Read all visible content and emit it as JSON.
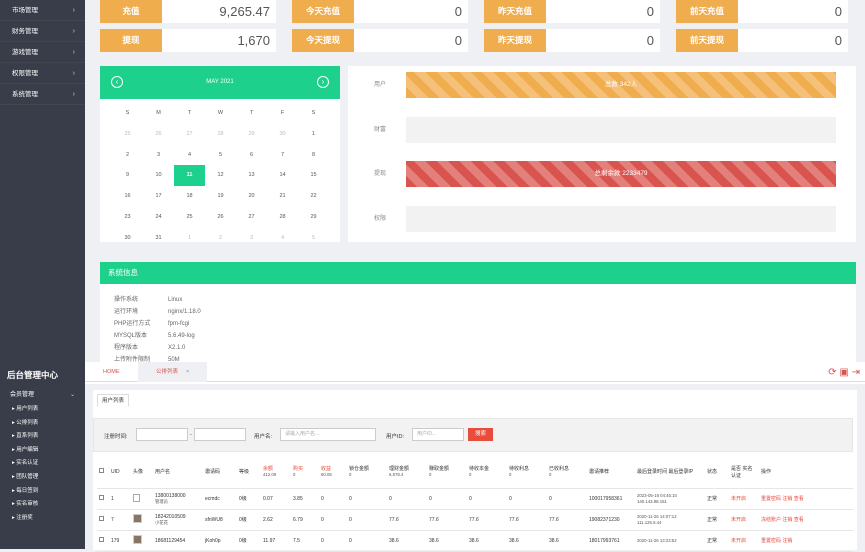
{
  "top_sidebar": {
    "items": [
      "市场管理",
      "财务管理",
      "游戏管理",
      "权限管理",
      "系统管理"
    ]
  },
  "stats": {
    "row1": [
      {
        "label": "充值",
        "value": "9,265.47"
      },
      {
        "label": "今天充值",
        "value": "0"
      },
      {
        "label": "昨天充值",
        "value": "0"
      },
      {
        "label": "前天充值",
        "value": "0"
      }
    ],
    "row2": [
      {
        "label": "提现",
        "value": "1,670"
      },
      {
        "label": "今天提现",
        "value": "0"
      },
      {
        "label": "昨天提现",
        "value": "0"
      },
      {
        "label": "前天提现",
        "value": "0"
      }
    ]
  },
  "calendar": {
    "month_label": "MAY 2021",
    "weekdays": [
      "S",
      "M",
      "T",
      "W",
      "T",
      "F",
      "S"
    ],
    "weeks": [
      [
        "25",
        "26",
        "27",
        "28",
        "29",
        "30",
        "1"
      ],
      [
        "2",
        "3",
        "4",
        "5",
        "6",
        "7",
        "8"
      ],
      [
        "9",
        "10",
        "11",
        "12",
        "13",
        "14",
        "15"
      ],
      [
        "16",
        "17",
        "18",
        "19",
        "20",
        "21",
        "22"
      ],
      [
        "23",
        "24",
        "25",
        "26",
        "27",
        "28",
        "29"
      ],
      [
        "30",
        "31",
        "1",
        "2",
        "3",
        "4",
        "5"
      ]
    ],
    "today": "11"
  },
  "progress": {
    "rows": [
      {
        "label": "用户",
        "text": "总数 342人",
        "fill": 1.0,
        "color": "orange"
      },
      {
        "label": "财富",
        "text": "",
        "fill": 0,
        "color": "none"
      },
      {
        "label": "提现",
        "text": "总剩余款 2233479",
        "fill": 1.0,
        "color": "red"
      },
      {
        "label": "权限",
        "text": "",
        "fill": 0,
        "color": "none"
      }
    ]
  },
  "sysinfo": {
    "title": "系统信息",
    "rows": [
      {
        "k": "操作系统",
        "v": "Linux"
      },
      {
        "k": "运行环境",
        "v": "nginx/1.18.0"
      },
      {
        "k": "PHP运行方式",
        "v": "fpm-fcgi"
      },
      {
        "k": "MYSQL版本",
        "v": "5.6.49-log"
      },
      {
        "k": "程序版本",
        "v": "X2.1.0"
      },
      {
        "k": "上传附件限制",
        "v": "50M"
      }
    ]
  },
  "sidebar": {
    "brand": "后台管理中心",
    "group": "会员管理",
    "items": [
      "用户列表",
      "公排列表",
      "直系列表",
      "用户编辑",
      "实名认证",
      "团队管理",
      "每日签到",
      "实名审核",
      "注册奖"
    ]
  },
  "tabs": {
    "home": "HOME",
    "current": "公排列表",
    "close": "×"
  },
  "panel": {
    "tab": "用户列表",
    "filter": {
      "time_label": "注册时间:",
      "dash": "-",
      "user_label": "用户名:",
      "user_placeholder": "请输入用户名...",
      "uid_label": "用户ID:",
      "uid_placeholder": "用户ID...",
      "search_btn": "搜索"
    },
    "headers": [
      "UID",
      "头像",
      "用户名",
      "邀请码",
      "等级",
      "余额",
      "购买",
      "收益",
      "锁仓金额",
      "理财金额",
      "赚取金额",
      "待收本金",
      "待收利息",
      "已收利息",
      "邀请推荐",
      "最后登录时间 最后登录IP",
      "状态",
      "是否 实名认证",
      "操作"
    ],
    "header_sub": {
      "余额": "412.09",
      "购买": "0",
      "收益": "60.05",
      "锁仓金额": "0",
      "理财金额": "6,578.4",
      "赚取金额": "0",
      "待收本金": "0",
      "待收利息": "0",
      "已收利息": "0"
    },
    "rows": [
      {
        "uid": "1",
        "avatar": "broken",
        "user": "13800138000 ",
        "user2": "管理员",
        "code": "ecmdc",
        "level": "0级",
        "bal": "0.07",
        "buy": "3.85",
        "inc": "0",
        "lock": "0",
        "fin": "0",
        "earn": "0",
        "prin": "0",
        "intr": "0",
        "got": "0",
        "inv": "100017958361",
        "login": "2023-05-16 04:45:10",
        "ip": "140.143.98.151",
        "status": "正常",
        "real": "未开启",
        "ops": "重置密码 注销 查看"
      },
      {
        "uid": "7",
        "avatar": "photo",
        "user": "18242010509",
        "user2": "小花花",
        "code": "sfnWU8",
        "level": "0级",
        "bal": "2.62",
        "buy": "6.79",
        "inc": "0",
        "lock": "0",
        "fin": "77.6",
        "earn": "77.6",
        "prin": "77.6",
        "intr": "77.6",
        "got": "77.6",
        "inv": "19082371230",
        "login": "2020-11-26 14:07:12",
        "ip": "111.126.6.44",
        "status": "正常",
        "real": "未开启",
        "ops": "冻结账户 注销 查看"
      },
      {
        "uid": "179",
        "avatar": "photo",
        "user": "18681129454",
        "user2": "",
        "code": "jKoh0p",
        "level": "0级",
        "bal": "11.97",
        "buy": "7.5",
        "inc": "0",
        "lock": "0",
        "fin": "38.6",
        "earn": "38.6",
        "prin": "38.6",
        "intr": "38.6",
        "got": "38.6",
        "inv": "18017993761",
        "login": "2020-11-26 13:23:52",
        "ip": "",
        "status": "正常",
        "real": "未开启",
        "ops": "重置密码 注销"
      }
    ]
  }
}
